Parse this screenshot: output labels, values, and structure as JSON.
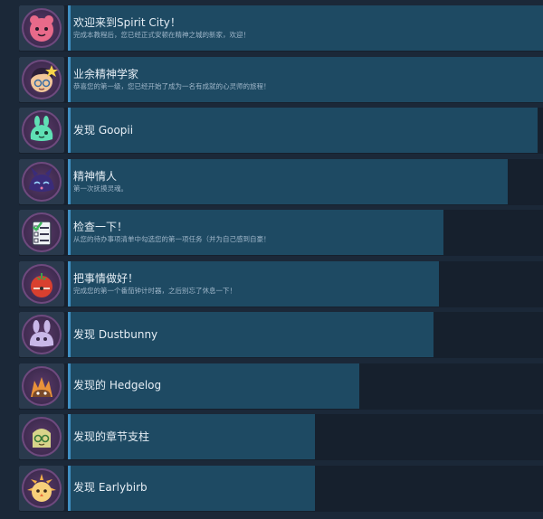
{
  "achievements": [
    {
      "title": "欢迎来到Spirit City！",
      "description": "完成本教程后，您已经正式安顿在精神之城的新家，欢迎！",
      "progress": 1.0,
      "icon": "pink-spirit-icon"
    },
    {
      "title": "业余精神学家",
      "description": "恭喜您的第一级，您已经开始了成为一名有成就的心灵师的旅程！",
      "progress": 1.0,
      "icon": "spiritologist-girl-icon"
    },
    {
      "title": "发现 Goopii",
      "description": "",
      "progress": 0.95,
      "icon": "goopii-icon"
    },
    {
      "title": "精神情人",
      "description": "第一次抚摸灵魂。",
      "progress": 0.89,
      "icon": "spirit-lover-icon"
    },
    {
      "title": "检查一下！",
      "description": "从您的待办事项清单中勾选您的第一项任务（并为自己感到自豪！",
      "progress": 0.76,
      "icon": "checklist-icon"
    },
    {
      "title": "把事情做好！",
      "description": "完成您的第一个番茄钟计时器，之后别忘了休息一下！",
      "progress": 0.75,
      "icon": "tomato-timer-icon"
    },
    {
      "title": "发现 Dustbunny",
      "description": "",
      "progress": 0.74,
      "icon": "dustbunny-icon"
    },
    {
      "title": "发现的 Hedgelog",
      "description": "",
      "progress": 0.59,
      "icon": "hedgelog-icon"
    },
    {
      "title": "发现的章节支柱",
      "description": "",
      "progress": 0.5,
      "icon": "chapter-pillar-icon"
    },
    {
      "title": "发现 Earlybirb",
      "description": "",
      "progress": 0.5,
      "icon": "earlybirb-icon"
    }
  ],
  "colors": {
    "background": "#1b2838",
    "bar_fill": "#1e4a63",
    "bar_track": "#16202d",
    "title_text": "#e6eef5",
    "description_text": "#9fb6c9"
  }
}
